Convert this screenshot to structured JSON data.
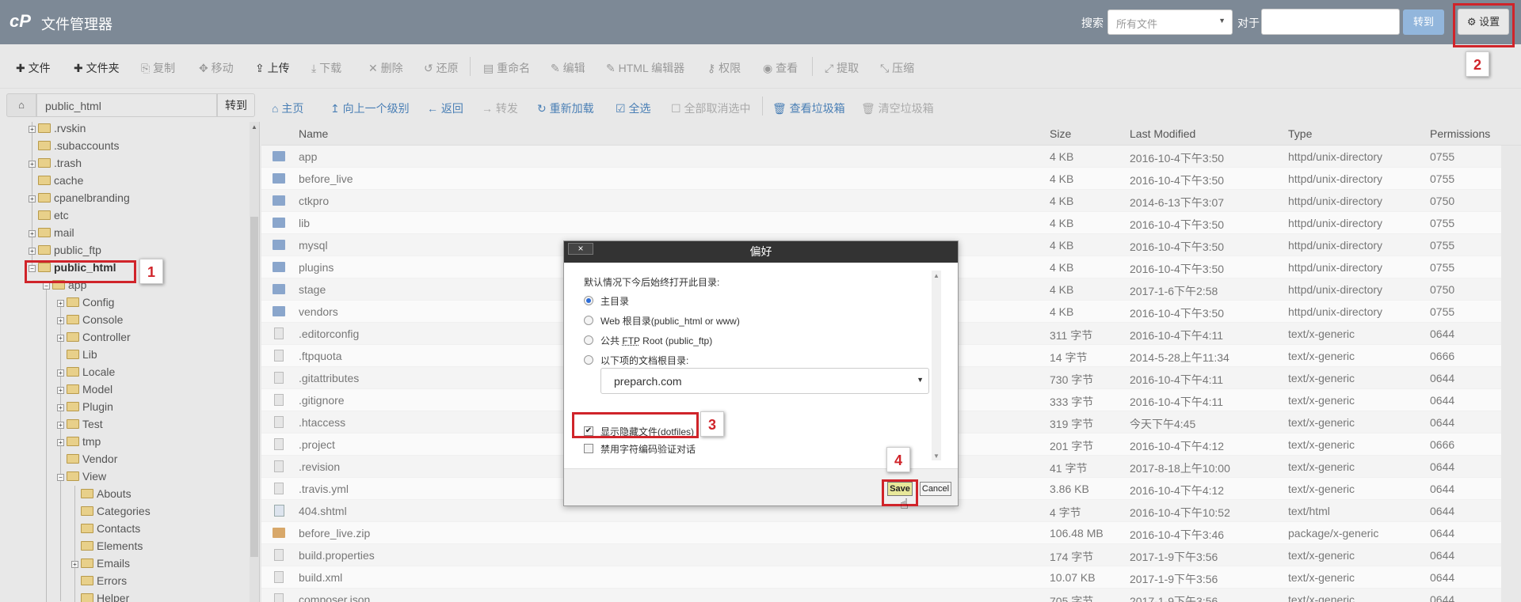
{
  "header": {
    "logo": "cP",
    "title": "文件管理器",
    "search_label": "搜索",
    "search_scope": "所有文件",
    "for_label": "对于",
    "go_label": "转到",
    "settings_label": "设置"
  },
  "toolbar": {
    "new_file": "文件",
    "new_folder": "文件夹",
    "copy": "复制",
    "move": "移动",
    "upload": "上传",
    "download": "下载",
    "delete": "删除",
    "restore": "还原",
    "rename": "重命名",
    "edit": "编辑",
    "html_editor": "HTML 编辑器",
    "permissions": "权限",
    "view": "查看",
    "extract": "提取",
    "compress": "压缩"
  },
  "pathbar": {
    "path": "public_html",
    "go": "转到",
    "home": "主页",
    "up": "向上一个级别",
    "back": "返回",
    "forward": "转发",
    "reload": "重新加载",
    "select_all": "全选",
    "deselect_all": "全部取消选中",
    "view_trash": "查看垃圾箱",
    "empty_trash": "清空垃圾箱"
  },
  "tree": {
    "items": [
      {
        "label": ".rvskin",
        "expand": true
      },
      {
        "label": ".subaccounts",
        "expand": false
      },
      {
        "label": ".trash",
        "expand": true
      },
      {
        "label": "cache",
        "expand": false
      },
      {
        "label": "cpanelbranding",
        "expand": true
      },
      {
        "label": "etc",
        "expand": false
      },
      {
        "label": "mail",
        "expand": true
      },
      {
        "label": "public_ftp",
        "expand": true
      },
      {
        "label": "public_html",
        "expand": true
      },
      {
        "label": "app",
        "expand": true
      },
      {
        "label": "Config",
        "expand": true
      },
      {
        "label": "Console",
        "expand": true
      },
      {
        "label": "Controller",
        "expand": true
      },
      {
        "label": "Lib",
        "expand": false
      },
      {
        "label": "Locale",
        "expand": true
      },
      {
        "label": "Model",
        "expand": true
      },
      {
        "label": "Plugin",
        "expand": true
      },
      {
        "label": "Test",
        "expand": true
      },
      {
        "label": "tmp",
        "expand": true
      },
      {
        "label": "Vendor",
        "expand": false
      },
      {
        "label": "View",
        "expand": true
      },
      {
        "label": "Abouts",
        "expand": false
      },
      {
        "label": "Categories",
        "expand": false
      },
      {
        "label": "Contacts",
        "expand": false
      },
      {
        "label": "Elements",
        "expand": false
      },
      {
        "label": "Emails",
        "expand": true
      },
      {
        "label": "Errors",
        "expand": false
      },
      {
        "label": "Helper",
        "expand": false
      }
    ]
  },
  "table": {
    "headers": {
      "name": "Name",
      "size": "Size",
      "modified": "Last Modified",
      "type": "Type",
      "perms": "Permissions"
    },
    "rows": [
      {
        "icon": "dir",
        "name": "app",
        "size": "4 KB",
        "modified": "2016-10-4下午3:50",
        "type": "httpd/unix-directory",
        "perms": "0755"
      },
      {
        "icon": "dir",
        "name": "before_live",
        "size": "4 KB",
        "modified": "2016-10-4下午3:50",
        "type": "httpd/unix-directory",
        "perms": "0755"
      },
      {
        "icon": "dir",
        "name": "ctkpro",
        "size": "4 KB",
        "modified": "2014-6-13下午3:07",
        "type": "httpd/unix-directory",
        "perms": "0750"
      },
      {
        "icon": "dir",
        "name": "lib",
        "size": "4 KB",
        "modified": "2016-10-4下午3:50",
        "type": "httpd/unix-directory",
        "perms": "0755"
      },
      {
        "icon": "dir",
        "name": "mysql",
        "size": "4 KB",
        "modified": "2016-10-4下午3:50",
        "type": "httpd/unix-directory",
        "perms": "0755"
      },
      {
        "icon": "dir",
        "name": "plugins",
        "size": "4 KB",
        "modified": "2016-10-4下午3:50",
        "type": "httpd/unix-directory",
        "perms": "0755"
      },
      {
        "icon": "dir",
        "name": "stage",
        "size": "4 KB",
        "modified": "2017-1-6下午2:58",
        "type": "httpd/unix-directory",
        "perms": "0750"
      },
      {
        "icon": "dir",
        "name": "vendors",
        "size": "4 KB",
        "modified": "2016-10-4下午3:50",
        "type": "httpd/unix-directory",
        "perms": "0755"
      },
      {
        "icon": "file",
        "name": ".editorconfig",
        "size": "311 字节",
        "modified": "2016-10-4下午4:11",
        "type": "text/x-generic",
        "perms": "0644"
      },
      {
        "icon": "file",
        "name": ".ftpquota",
        "size": "14 字节",
        "modified": "2014-5-28上午11:34",
        "type": "text/x-generic",
        "perms": "0666"
      },
      {
        "icon": "file",
        "name": ".gitattributes",
        "size": "730 字节",
        "modified": "2016-10-4下午4:11",
        "type": "text/x-generic",
        "perms": "0644"
      },
      {
        "icon": "file",
        "name": ".gitignore",
        "size": "333 字节",
        "modified": "2016-10-4下午4:11",
        "type": "text/x-generic",
        "perms": "0644"
      },
      {
        "icon": "file",
        "name": ".htaccess",
        "size": "319 字节",
        "modified": "今天下午4:45",
        "type": "text/x-generic",
        "perms": "0644"
      },
      {
        "icon": "file",
        "name": ".project",
        "size": "201 字节",
        "modified": "2016-10-4下午4:12",
        "type": "text/x-generic",
        "perms": "0666"
      },
      {
        "icon": "file",
        "name": ".revision",
        "size": "41 字节",
        "modified": "2017-8-18上午10:00",
        "type": "text/x-generic",
        "perms": "0644"
      },
      {
        "icon": "file",
        "name": ".travis.yml",
        "size": "3.86 KB",
        "modified": "2016-10-4下午4:12",
        "type": "text/x-generic",
        "perms": "0644"
      },
      {
        "icon": "html",
        "name": "404.shtml",
        "size": "4 字节",
        "modified": "2016-10-4下午10:52",
        "type": "text/html",
        "perms": "0644"
      },
      {
        "icon": "zip",
        "name": "before_live.zip",
        "size": "106.48 MB",
        "modified": "2016-10-4下午3:46",
        "type": "package/x-generic",
        "perms": "0644"
      },
      {
        "icon": "file",
        "name": "build.properties",
        "size": "174 字节",
        "modified": "2017-1-9下午3:56",
        "type": "text/x-generic",
        "perms": "0644"
      },
      {
        "icon": "file",
        "name": "build.xml",
        "size": "10.07 KB",
        "modified": "2017-1-9下午3:56",
        "type": "text/x-generic",
        "perms": "0644"
      },
      {
        "icon": "file",
        "name": "composer.json",
        "size": "705 字节",
        "modified": "2017-1-9下午3:56",
        "type": "text/x-generic",
        "perms": "0644"
      }
    ]
  },
  "modal": {
    "title": "偏好",
    "close": "×",
    "intro": "默认情况下今后始终打开此目录:",
    "opt_home": "主目录",
    "opt_web": "Web 根目录(public_html or www)",
    "opt_ftp_prefix": "公共",
    "opt_ftp_abbr": "FTP",
    "opt_ftp_suffix": "Root (public_ftp)",
    "opt_docroot": "以下项的文档根目录:",
    "docroot_value": "preparch.com",
    "show_hidden": "显示隐藏文件(dotfiles)",
    "disable_charset": "禁用字符编码验证对话",
    "save": "Save",
    "cancel": "Cancel"
  },
  "callouts": [
    "1",
    "2",
    "3",
    "4"
  ],
  "colors": {
    "header_bg": "#7d8996",
    "link": "#4a7fb5",
    "callout": "#d0242a",
    "save_bg": "#e8e89a"
  }
}
